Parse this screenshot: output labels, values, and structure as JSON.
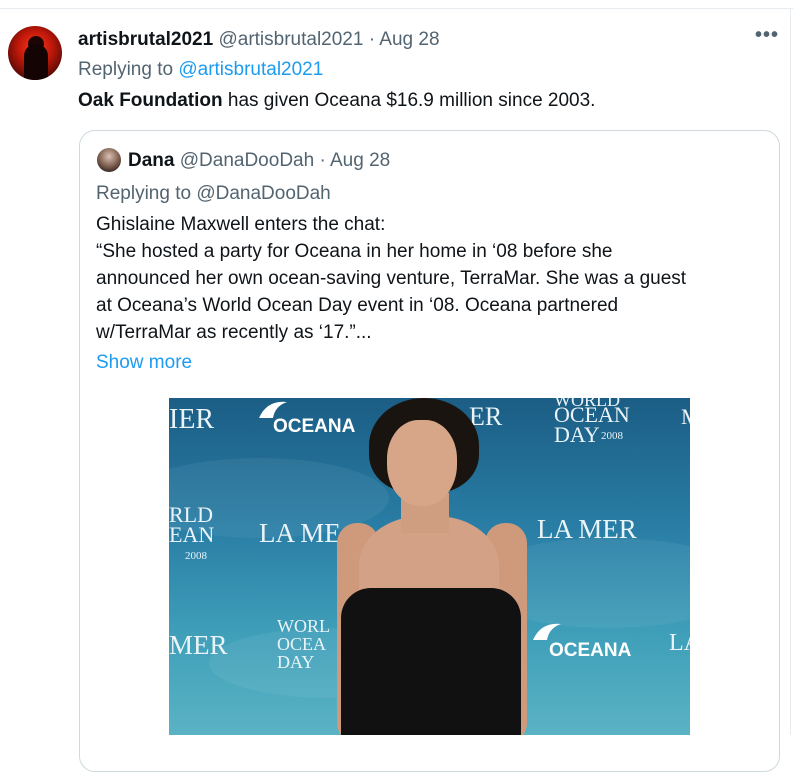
{
  "tweet": {
    "display_name": "artisbrutal2021",
    "handle": "@artisbrutal2021",
    "date": "· Aug 28",
    "replying_prefix": "Replying to",
    "replying_to": "@artisbrutal2021",
    "text_bold": "Oak Foundation",
    "text_rest": " has given Oceana $16.9 million since 2003.",
    "more_icon": "more-horizontal-icon"
  },
  "quote": {
    "display_name": "Dana",
    "handle": "@DanaDooDah",
    "date": "· Aug 28",
    "replying": "Replying to @DanaDooDah",
    "lines": [
      "Ghislaine Maxwell enters the chat:",
      "“She hosted a party for Oceana in her home in ‘08 before she",
      "announced her own ocean-saving venture, TerraMar. She was a guest",
      "at Oceana’s World Ocean Day event in ‘08. Oceana partnered",
      "w/TerraMar as recently as ‘17.”..."
    ],
    "show_more": "Show more",
    "photo": {
      "backdrop_texts": {
        "mer_top_left": "IER",
        "oceana_top": "OCEANA",
        "er_top_mid": "ER",
        "world_ocean_day_top_right": "WORLD",
        "ocean_top_right": "OCEAN",
        "day_top_right": "DAY",
        "year_top_right": "2008",
        "m_top_far_right": "M",
        "rld_left": "RLD",
        "ean_left": "EAN",
        "year_left": "2008",
        "la_mer_left": "LA ME",
        "la_mer_right": "LA MER",
        "mer_bottom_left": "MER",
        "worl_bottom": "WORL",
        "ocea_bottom": "OCEA",
        "day_bottom": "DAY",
        "oceana_bottom": "OCEANA",
        "la_bottom_right": "LA"
      }
    }
  }
}
